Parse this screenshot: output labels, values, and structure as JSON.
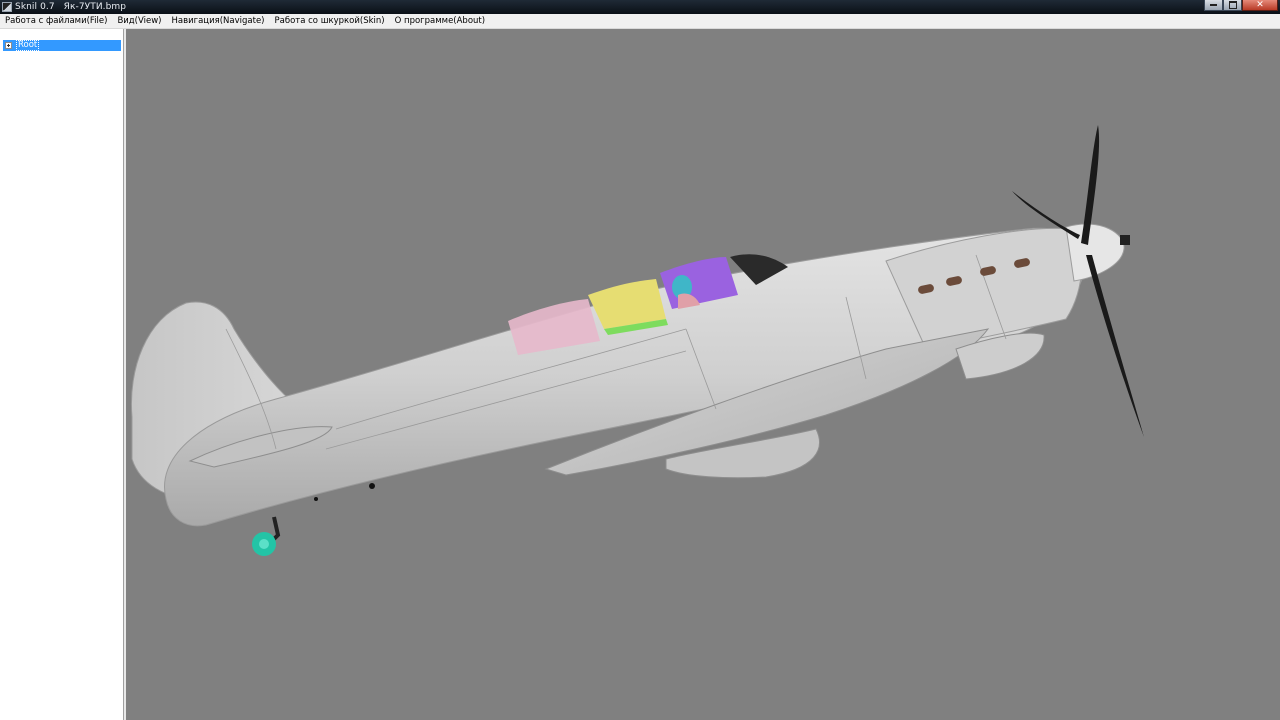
{
  "window": {
    "title": "Sknil 0.7   Як-7УТИ.bmp"
  },
  "menu": {
    "items": [
      {
        "label": "Работа с файлами(File)"
      },
      {
        "label": "Вид(View)"
      },
      {
        "label": "Навигация(Navigate)"
      },
      {
        "label": "Работа со шкуркой(Skin)"
      },
      {
        "label": "О программе(About)"
      }
    ]
  },
  "tree": {
    "root": {
      "label": "Root",
      "selected": true,
      "expanded": false
    }
  },
  "viewport": {
    "background": "#808080",
    "model_colors": {
      "fuselage": "#c8c8c8",
      "canopy_pink": "#e6b4c8",
      "canopy_yellow": "#e8e070",
      "canopy_green": "#7ee060",
      "canopy_purple": "#9a60e0",
      "pilot_cyan": "#40b8c8",
      "propeller": "#1a1a1a",
      "tail_wheel": "#20c0a0",
      "exhaust": "#6a4a38"
    }
  },
  "colors": {
    "selection": "#3399ff",
    "menubar_bg": "#f0f0f0",
    "titlebar_bg": "#0f1620"
  }
}
